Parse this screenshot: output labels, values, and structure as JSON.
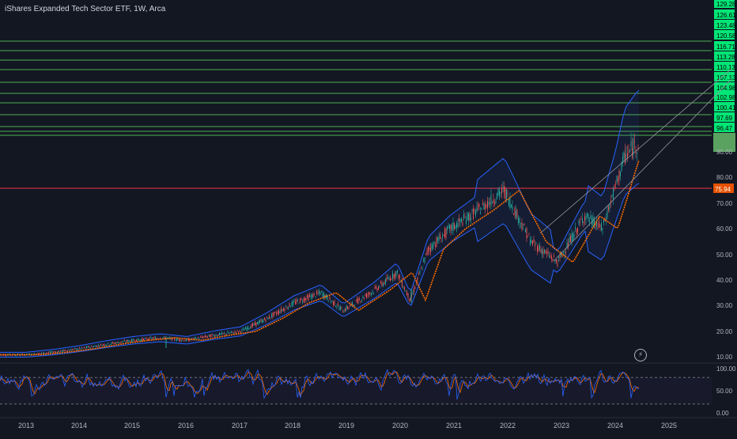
{
  "chart_title": "iShares Expanded Tech Sector ETF, 1W, Arca",
  "flash_icon": "lightning-icon",
  "colors": {
    "background": "#131722",
    "up": "#26a69a",
    "down": "#ef5350",
    "ma": "#ff6d00",
    "band": "#2962ff",
    "level_line": "#4caf50",
    "level_label_bg": "#00e676",
    "support_line": "#f23645",
    "current_label_bg": "#66bb6a",
    "support_label_bg": "#e65100",
    "stoch_k": "#2962ff",
    "stoch_d": "#ff6d00"
  },
  "chart_data": {
    "type": "candlestick",
    "title": "iShares Expanded Tech Sector ETF, 1W, Arca",
    "x_labels": [
      "2013",
      "2014",
      "2015",
      "2016",
      "2017",
      "2018",
      "2019",
      "2020",
      "2021",
      "2022",
      "2023",
      "2024",
      "2025"
    ],
    "y_ticks": [
      10.0,
      20.0,
      30.0,
      40.0,
      50.0,
      60.0,
      70.0,
      80.0,
      90.0
    ],
    "y_range": [
      10,
      129.28
    ],
    "fib_levels": [
      "129.28",
      "126.61",
      "123.48",
      "120.58",
      "116.71",
      "113.28",
      "110.13",
      "107.13",
      "104.98",
      "102.98",
      "100.41",
      "97.69",
      "96.47"
    ],
    "last_price_label": "",
    "support_level": "75.94",
    "price_path": [
      [
        "2013-01",
        10.8
      ],
      [
        "2013-07",
        11.8
      ],
      [
        "2014-01",
        13.2
      ],
      [
        "2014-07",
        15.0
      ],
      [
        "2015-01",
        16.5
      ],
      [
        "2015-07",
        17.5
      ],
      [
        "2016-01",
        16.5
      ],
      [
        "2016-07",
        18.5
      ],
      [
        "2017-01",
        20.0
      ],
      [
        "2017-07",
        25.0
      ],
      [
        "2018-01",
        31.0
      ],
      [
        "2018-07",
        35.0
      ],
      [
        "2018-12",
        28.0
      ],
      [
        "2019-07",
        36.0
      ],
      [
        "2019-12",
        43.0
      ],
      [
        "2020-03",
        32.0
      ],
      [
        "2020-07",
        52.0
      ],
      [
        "2020-12",
        60.0
      ],
      [
        "2021-06",
        67.0
      ],
      [
        "2021-12",
        75.0
      ],
      [
        "2022-06",
        55.0
      ],
      [
        "2022-12",
        47.0
      ],
      [
        "2023-06",
        65.0
      ],
      [
        "2023-10",
        60.0
      ],
      [
        "2024-03",
        88.0
      ],
      [
        "2024-06",
        93.0
      ]
    ],
    "oscillator": {
      "y_ticks": [
        0.0,
        50.0,
        100.0
      ],
      "levels": [
        20,
        80
      ]
    }
  }
}
